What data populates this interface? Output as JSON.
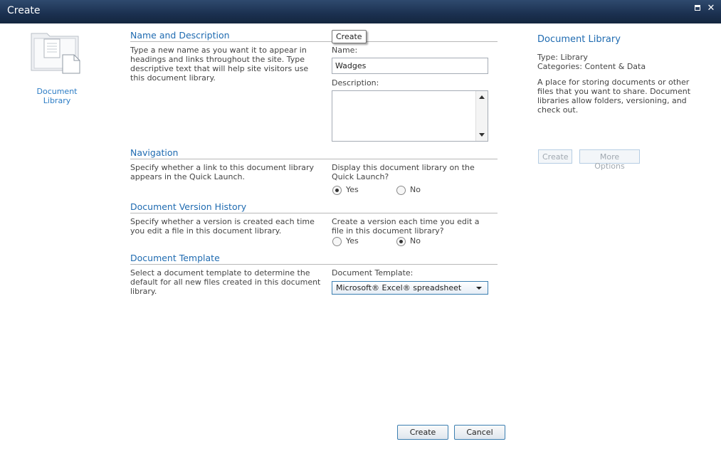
{
  "window": {
    "title": "Create"
  },
  "left": {
    "item_label": "Document Library"
  },
  "form": {
    "tooltip": "Create",
    "name_section": {
      "heading": "Name and Description",
      "desc": "Type a new name as you want it to appear in headings and links throughout the site. Type descriptive text that will help site visitors use this document library.",
      "name_label": "Name:",
      "name_value": "Wadges",
      "description_label": "Description:",
      "description_value": ""
    },
    "navigation": {
      "heading": "Navigation",
      "desc": "Specify whether a link to this document library appears in the Quick Launch.",
      "question": "Display this document library on the Quick Launch?",
      "yes": "Yes",
      "no": "No",
      "selected": "Yes"
    },
    "version": {
      "heading": "Document Version History",
      "desc": "Specify whether a version is created each time you edit a file in this document library.",
      "question": "Create a version each time you edit a file in this document library?",
      "yes": "Yes",
      "no": "No",
      "selected": "No"
    },
    "template": {
      "heading": "Document Template",
      "desc": "Select a document template to determine the default for all new files created in this document library.",
      "label": "Document Template:",
      "selected": "Microsoft® Excel® spreadsheet"
    }
  },
  "right": {
    "title": "Document Library",
    "type": "Type: Library",
    "categories": "Categories: Content & Data",
    "description": "A place for storing documents or other files that you want to share. Document libraries allow folders, versioning, and check out.",
    "create_label": "Create",
    "more_label": "More Options"
  },
  "footer": {
    "create_label": "Create",
    "cancel_label": "Cancel"
  }
}
